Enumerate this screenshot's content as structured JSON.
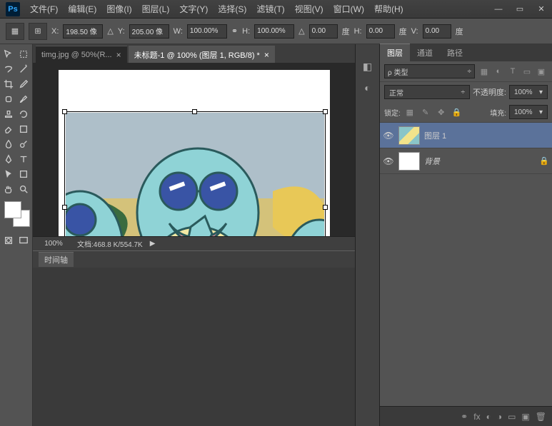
{
  "app": {
    "logo_text": "Ps"
  },
  "menu": {
    "file": "文件(F)",
    "edit": "编辑(E)",
    "image": "图像(I)",
    "layer": "图层(L)",
    "type": "文字(Y)",
    "select": "选择(S)",
    "filter": "滤镜(T)",
    "view": "视图(V)",
    "window": "窗口(W)",
    "help": "帮助(H)"
  },
  "options": {
    "x_label": "X:",
    "x_value": "198.50 像",
    "y_label": "Y:",
    "y_value": "205.00 像",
    "w_label": "W:",
    "w_value": "100.00%",
    "h_label": "H:",
    "h_value": "100.00%",
    "angle_label": "",
    "angle_value": "0.00",
    "angle_unit": "度",
    "h2_label": "H:",
    "h2_value": "0.00",
    "h2_unit": "度",
    "v_label": "V:",
    "v_value": "0.00",
    "v_unit": "度"
  },
  "tabs": {
    "tab1": "timg.jpg @ 50%(R...",
    "tab2": "未标题-1 @ 100% (图层 1, RGB/8) *"
  },
  "status": {
    "zoom": "100%",
    "doc": "文档:468.8 K/554.7K"
  },
  "timeline": {
    "label": "时间轴"
  },
  "panels": {
    "layers_tab": "图层",
    "channels_tab": "通道",
    "paths_tab": "路径",
    "filter_label": "类型",
    "filter_prefix": "ρ",
    "blend_mode": "正常",
    "opacity_label": "不透明度:",
    "opacity_value": "100%",
    "lock_label": "锁定:",
    "fill_label": "填充:",
    "fill_value": "100%",
    "layer1_name": "图层 1",
    "bg_name": "背景"
  }
}
